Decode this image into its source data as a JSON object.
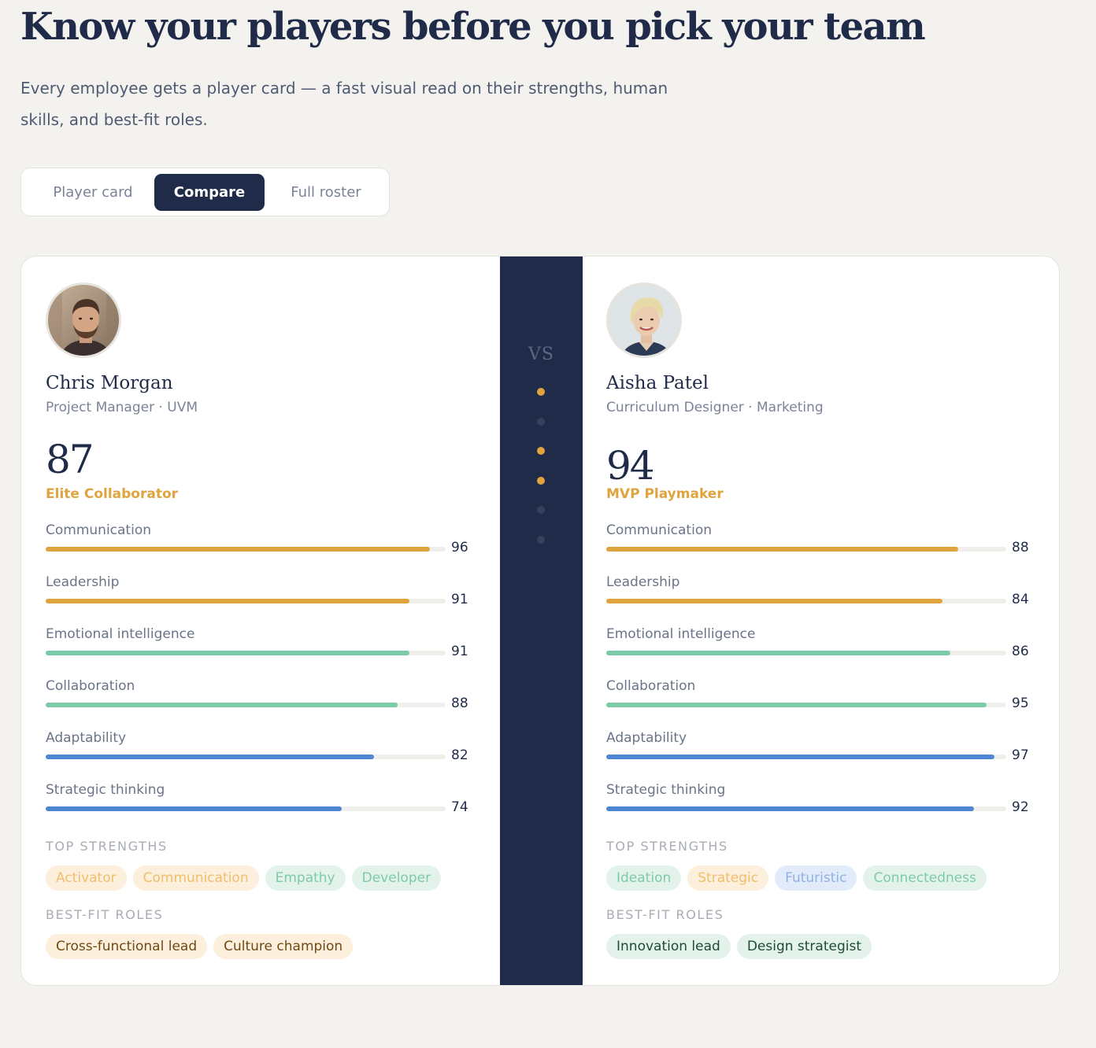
{
  "hero": {
    "title": "Know your players before you pick your team",
    "subtitle": "Every employee gets a player card — a fast visual read on their strengths, human skills, and best-fit roles."
  },
  "tabs": [
    {
      "label": "Player card",
      "active": false
    },
    {
      "label": "Compare",
      "active": true
    },
    {
      "label": "Full roster",
      "active": false
    }
  ],
  "vs": {
    "label": "VS",
    "indicator_dots": [
      "on",
      "off",
      "on",
      "on",
      "off",
      "off"
    ]
  },
  "section_labels": {
    "strengths": "TOP STRENGTHS",
    "roles": "BEST-FIT ROLES"
  },
  "colors": {
    "navy": "#1f2b48",
    "gold": "#e0a43e",
    "green": "#7ccba8",
    "blue": "#4f86d3",
    "background": "#f3f2ee"
  },
  "players": [
    {
      "name": "Chris Morgan",
      "meta": "Project Manager · UVM",
      "score": "87",
      "tier": "Elite Collaborator",
      "avatar": "avatar-photo-man",
      "skills": [
        {
          "label": "Communication",
          "value": 96,
          "color": "gold"
        },
        {
          "label": "Leadership",
          "value": 91,
          "color": "gold"
        },
        {
          "label": "Emotional intelligence",
          "value": 91,
          "color": "green"
        },
        {
          "label": "Collaboration",
          "value": 88,
          "color": "green"
        },
        {
          "label": "Adaptability",
          "value": 82,
          "color": "blue"
        },
        {
          "label": "Strategic thinking",
          "value": 74,
          "color": "blue"
        }
      ],
      "strengths": [
        {
          "label": "Activator",
          "tone": "gold"
        },
        {
          "label": "Communication",
          "tone": "gold"
        },
        {
          "label": "Empathy",
          "tone": "green"
        },
        {
          "label": "Developer",
          "tone": "green"
        }
      ],
      "roles": [
        {
          "label": "Cross-functional lead",
          "tone": "gold-dark"
        },
        {
          "label": "Culture champion",
          "tone": "gold-dark"
        }
      ]
    },
    {
      "name": "Aisha Patel",
      "meta": "Curriculum Designer · Marketing",
      "score": "94",
      "tier": "MVP Playmaker",
      "avatar": "avatar-photo-woman",
      "skills": [
        {
          "label": "Communication",
          "value": 88,
          "color": "gold"
        },
        {
          "label": "Leadership",
          "value": 84,
          "color": "gold"
        },
        {
          "label": "Emotional intelligence",
          "value": 86,
          "color": "green"
        },
        {
          "label": "Collaboration",
          "value": 95,
          "color": "green"
        },
        {
          "label": "Adaptability",
          "value": 97,
          "color": "blue"
        },
        {
          "label": "Strategic thinking",
          "value": 92,
          "color": "blue"
        }
      ],
      "strengths": [
        {
          "label": "Ideation",
          "tone": "green"
        },
        {
          "label": "Strategic",
          "tone": "gold"
        },
        {
          "label": "Futuristic",
          "tone": "blue"
        },
        {
          "label": "Connectedness",
          "tone": "green"
        }
      ],
      "roles": [
        {
          "label": "Innovation lead",
          "tone": "green-dark"
        },
        {
          "label": "Design strategist",
          "tone": "green-dark"
        }
      ]
    }
  ]
}
